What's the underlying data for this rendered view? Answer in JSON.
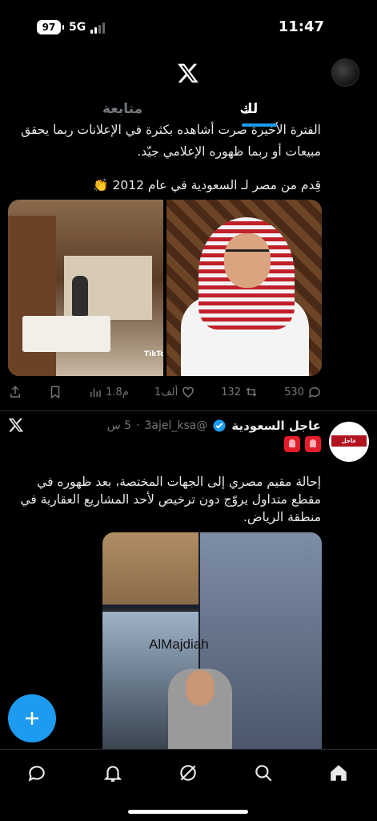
{
  "status_bar": {
    "battery": "97",
    "network": "5G",
    "time": "11:47"
  },
  "header": {
    "logo_icon": "x-logo-icon",
    "tabs": [
      {
        "label": "لك",
        "active": true
      },
      {
        "label": "متابعة",
        "active": false
      }
    ]
  },
  "post1": {
    "text_line1": "الفترة الأخيرة صرت أشاهده بكثرة في الإعلانات ربما يحقق",
    "text_line2": "مبيعات أو ربما ظهوره الإعلامي جيّد.",
    "text_line3": "قِدم من مصر لـ السعودية في عام 2012 👏",
    "media_watermark": "TikTok",
    "actions": {
      "replies": "530",
      "reposts": "132",
      "likes": "1ألف",
      "views": "1.8م"
    }
  },
  "post2": {
    "author_name": "عاجل السعودية",
    "handle": "@3ajel_ksa",
    "time": "5 س",
    "avatar_label": "عاجل السعودية",
    "text": "إحالة مقيم مصري إلى الجهات المختصة، بعد ظهوره في مقطع متداول يروّج دون ترخيص لأحد المشاريع العقارية في منطقة الرياض.",
    "media_text": "AlMajdiah"
  },
  "colors": {
    "accent": "#1d9bf0",
    "background": "#000000",
    "text": "#e7e9ea",
    "muted": "#71767b"
  }
}
